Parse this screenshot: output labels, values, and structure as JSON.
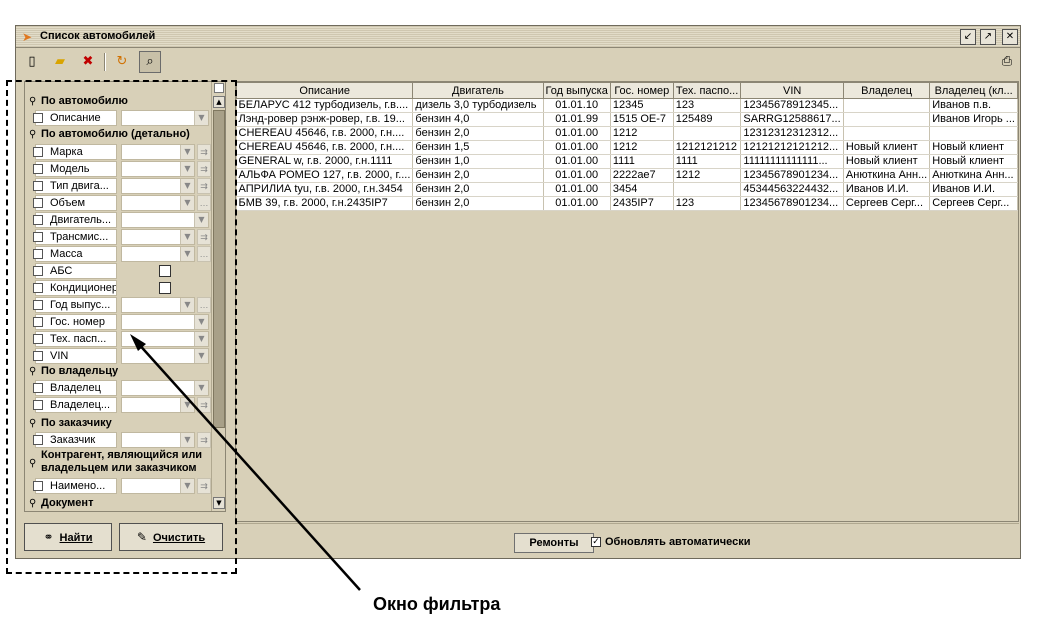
{
  "window": {
    "title": "Список автомобилей",
    "title_icon": "car-icon",
    "controls": [
      "minimize-icon",
      "maximize-icon",
      "close-icon"
    ]
  },
  "toolbar": {
    "buttons": [
      "new-document-icon",
      "open-folder-icon",
      "delete-icon",
      "refresh-icon",
      "find-icon"
    ],
    "print_icon": "printer-icon"
  },
  "filter": {
    "sections": {
      "car": "По автомобилю",
      "car_detail": "По автомобилю (детально)",
      "owner": "По владельцу",
      "customer": "По заказчику",
      "contractor": "Контрагент, являющийся или владельцем или заказчиком",
      "document": "Документ"
    },
    "fields": {
      "description": "Описание",
      "brand": "Марка",
      "model": "Модель",
      "engine_type": "Тип двига...",
      "volume": "Объем",
      "engine": "Двигатель...",
      "transmission": "Трансмис...",
      "mass": "Масса",
      "abs": "АБС",
      "aircon": "Кондиционер",
      "year": "Год выпус...",
      "plate": "Гос. номер",
      "tech_passport": "Тех. пасп...",
      "vin": "VIN",
      "owner": "Владелец",
      "owner2": "Владелец...",
      "customer": "Заказчик",
      "contractor_name": "Наимено..."
    },
    "find_label": "Найти",
    "clear_label": "Очистить"
  },
  "table": {
    "headers": [
      "Описание",
      "Двигатель",
      "Год выпуска",
      "Гос. номер",
      "Тех. паспо...",
      "VIN",
      "Владелец",
      "Владелец (кл..."
    ],
    "rows": [
      [
        "БЕЛАРУС 412 турбодизель, г.в....",
        "дизель 3,0 турбодизель",
        "01.01.10",
        "12345",
        "123",
        "12345678912345...",
        "",
        "Иванов п.в."
      ],
      [
        "Лэнд-ровер рэнж-ровер, г.в. 19...",
        "бензин 4,0",
        "01.01.99",
        "1515 ОЕ-7",
        "125489",
        "SARRG12588617...",
        "",
        "Иванов Игорь ..."
      ],
      [
        "CHEREAU 45646, г.в. 2000, г.н....",
        "бензин 2,0",
        "01.01.00",
        "1212",
        "",
        "12312312312312...",
        "",
        ""
      ],
      [
        "CHEREAU 45646, г.в. 2000, г.н....",
        "бензин 1,5",
        "01.01.00",
        "1212",
        "1212121212",
        "12121212121212...",
        "Новый клиент",
        "Новый клиент"
      ],
      [
        "GENERAL w, г.в. 2000, г.н.1111",
        "бензин 1,0",
        "01.01.00",
        "1111",
        "1111",
        "11111111111111...",
        "Новый клиент",
        "Новый клиент"
      ],
      [
        "АЛЬФА РОМЕО 127, г.в. 2000, г....",
        "бензин 2,0",
        "01.01.00",
        "2222ае7",
        "1212",
        "12345678901234...",
        "Анюткина Анн...",
        "Анюткина Анн..."
      ],
      [
        "АПРИЛИА tyu, г.в. 2000, г.н.3454",
        "бензин 2,0",
        "01.01.00",
        "3454",
        "",
        "45344563224432...",
        "Иванов И.И.",
        "Иванов И.И."
      ],
      [
        "БМВ 39, г.в. 2000, г.н.2435IP7",
        "бензин 2,0",
        "01.01.00",
        "2435IP7",
        "123",
        "12345678901234...",
        "Сергеев Серг...",
        "Сергеев Серг..."
      ]
    ]
  },
  "status": {
    "repairs_label": "Ремонты",
    "auto_refresh_label": "Обновлять автоматически",
    "auto_refresh_checked": true
  },
  "annotation": {
    "label": "Окно фильтра"
  }
}
